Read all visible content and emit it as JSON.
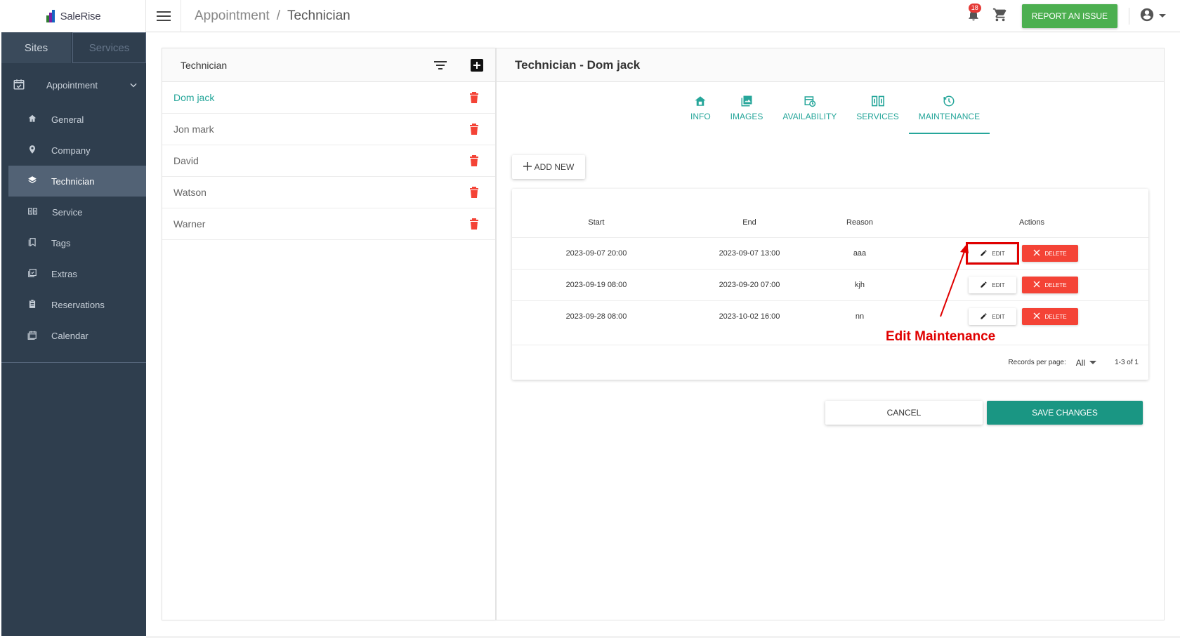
{
  "brand": {
    "logo_text": "SaleRise"
  },
  "sidebar": {
    "tabs": [
      {
        "label": "Sites"
      },
      {
        "label": "Services"
      }
    ],
    "group": {
      "label": "Appointment"
    },
    "items": [
      {
        "label": "General",
        "icon": "home-icon"
      },
      {
        "label": "Company",
        "icon": "location-pin-icon"
      },
      {
        "label": "Technician",
        "icon": "layers-icon",
        "active": true
      },
      {
        "label": "Service",
        "icon": "book-icon"
      },
      {
        "label": "Tags",
        "icon": "bookmark-icon"
      },
      {
        "label": "Extras",
        "icon": "checklist-icon"
      },
      {
        "label": "Reservations",
        "icon": "clipboard-icon"
      },
      {
        "label": "Calendar",
        "icon": "calendar-icon"
      }
    ]
  },
  "topbar": {
    "breadcrumb": [
      "Appointment",
      "Technician"
    ],
    "separator": "/",
    "notifications_count": "18",
    "report_label": "REPORT AN ISSUE"
  },
  "technician_list": {
    "title": "Technician",
    "items": [
      {
        "name": "Dom jack",
        "active": true
      },
      {
        "name": "Jon mark"
      },
      {
        "name": "David"
      },
      {
        "name": "Watson"
      },
      {
        "name": "Warner"
      }
    ]
  },
  "detail": {
    "title": "Technician - Dom jack",
    "tabs": [
      {
        "label": "INFO",
        "icon": "house-icon"
      },
      {
        "label": "IMAGES",
        "icon": "images-icon"
      },
      {
        "label": "AVAILABILITY",
        "icon": "availability-icon"
      },
      {
        "label": "SERVICES",
        "icon": "services-book-icon"
      },
      {
        "label": "MAINTENANCE",
        "icon": "maintenance-icon",
        "active": true
      }
    ],
    "add_new_label": "ADD NEW",
    "table": {
      "headers": {
        "start": "Start",
        "end": "End",
        "reason": "Reason",
        "actions": "Actions"
      },
      "rows": [
        {
          "start": "2023-09-07 20:00",
          "end": "2023-09-07 13:00",
          "reason": "aaa"
        },
        {
          "start": "2023-09-19 08:00",
          "end": "2023-09-20 07:00",
          "reason": "kjh"
        },
        {
          "start": "2023-09-28 08:00",
          "end": "2023-10-02 16:00",
          "reason": "nn"
        }
      ],
      "edit_label": "EDIT",
      "delete_label": "DELETE",
      "records_per_page_label": "Records per page:",
      "records_per_page_value": "All",
      "range": "1-3 of 1"
    },
    "annotation": "Edit Maintenance",
    "cancel_label": "CANCEL",
    "save_label": "SAVE CHANGES"
  },
  "colors": {
    "sidebar_bg": "#2f3e4e",
    "accent_teal": "#26a69a",
    "save_button": "#1a9683",
    "report_button": "#4caf50",
    "danger": "#f44336",
    "annotation_red": "#e00000"
  }
}
